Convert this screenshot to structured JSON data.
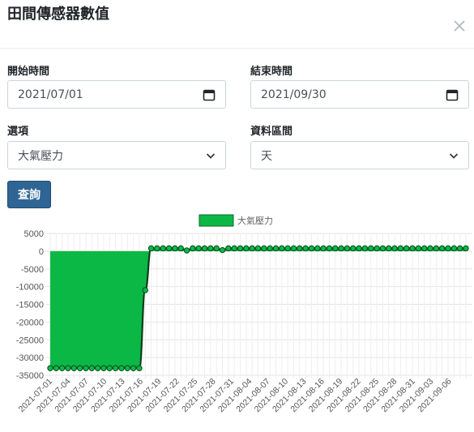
{
  "modal": {
    "title": "田間傳感器數值"
  },
  "form": {
    "start_label": "開始時間",
    "start_value": "2021/07/01",
    "end_label": "結束時間",
    "end_value": "2021/09/30",
    "option_label": "選項",
    "option_value": "大氣壓力",
    "interval_label": "資料區間",
    "interval_value": "天",
    "query_label": "查詢"
  },
  "colors": {
    "series_fill": "#0cb845",
    "series_line": "#0a3d1a",
    "button": "#2f6594"
  },
  "chart_data": {
    "type": "area",
    "legend": [
      "大氣壓力"
    ],
    "legend_position": "top",
    "ylim": [
      -35000,
      5000
    ],
    "yticks": [
      5000,
      0,
      -5000,
      -10000,
      -15000,
      -20000,
      -25000,
      -30000,
      -35000
    ],
    "xtick_labels": [
      "2021-07-01",
      "2021-07-04",
      "2021-07-07",
      "2021-07-10",
      "2021-07-13",
      "2021-07-16",
      "2021-07-19",
      "2021-07-22",
      "2021-07-25",
      "2021-07-28",
      "2021-07-31",
      "2021-08-04",
      "2021-08-07",
      "2021-08-10",
      "2021-08-13",
      "2021-08-16",
      "2021-08-19",
      "2021-08-22",
      "2021-08-25",
      "2021-08-28",
      "2021-08-31",
      "2021-09-03",
      "2021-09-06"
    ],
    "grid": true,
    "series": [
      {
        "name": "大氣壓力",
        "values": [
          -33000,
          -33000,
          -33000,
          -33000,
          -33000,
          -33000,
          -33000,
          -33000,
          -33000,
          -33000,
          -33000,
          -33000,
          -33000,
          -33000,
          -33000,
          -33000,
          -11000,
          800,
          800,
          800,
          800,
          800,
          800,
          200,
          800,
          800,
          800,
          800,
          800,
          300,
          800,
          800,
          800,
          800,
          800,
          800,
          800,
          800,
          800,
          800,
          800,
          800,
          800,
          800,
          800,
          800,
          800,
          800,
          800,
          800,
          800,
          800,
          800,
          800,
          800,
          800,
          800,
          800,
          800,
          800,
          800,
          800,
          800,
          800,
          800,
          800,
          800,
          800,
          800,
          800,
          800
        ]
      }
    ]
  }
}
